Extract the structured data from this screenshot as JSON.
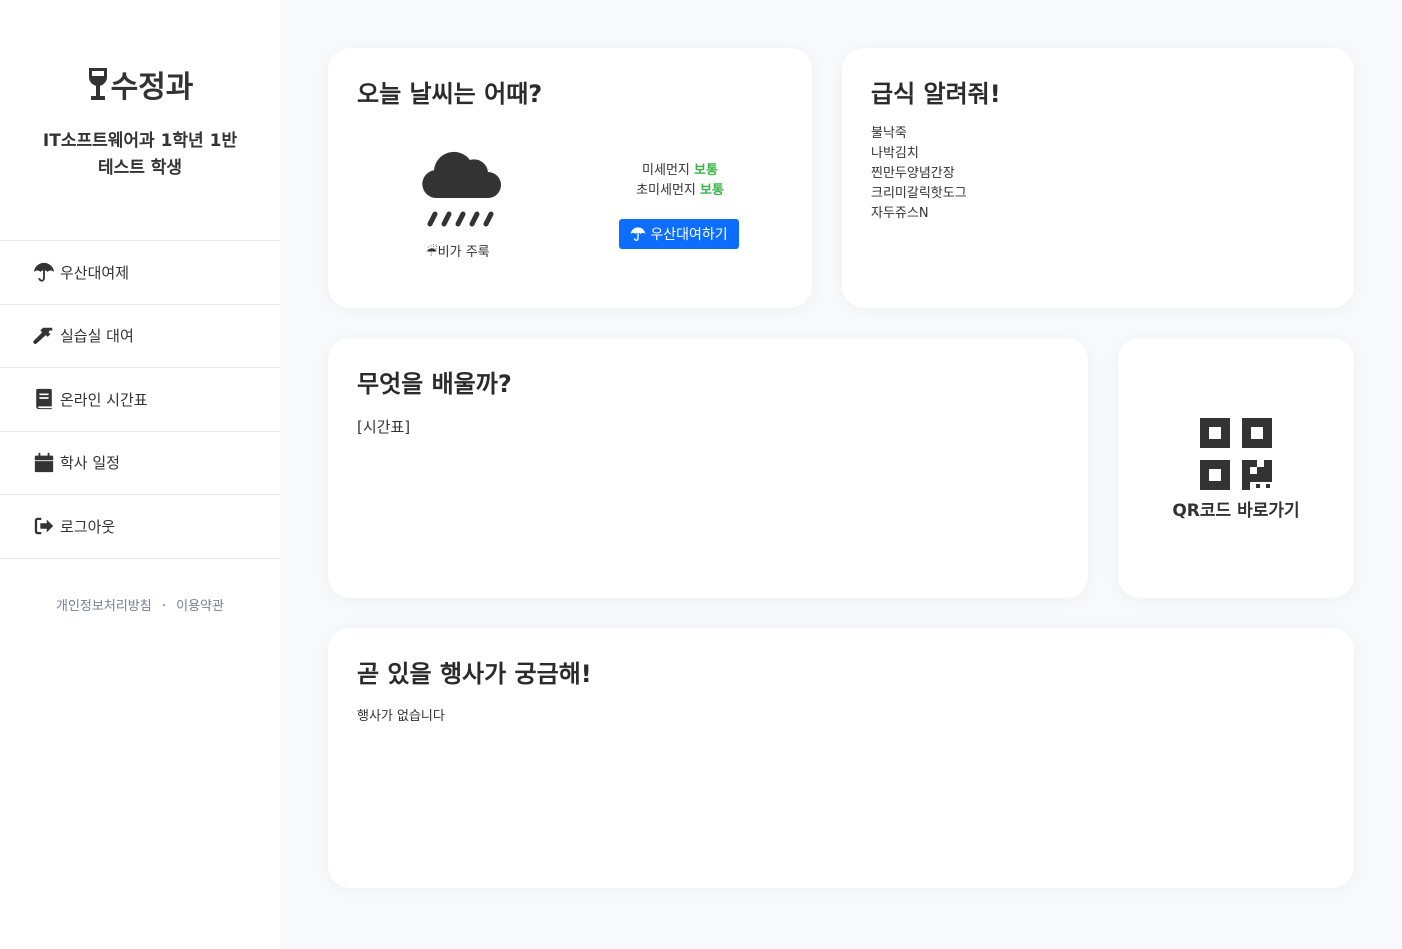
{
  "brand": {
    "title": "수정과",
    "class_line": "IT소프트웨어과 1학년 1반",
    "student_name": "테스트 학생",
    "icon": "wine-glass-icon"
  },
  "nav": [
    {
      "label": "우산대여제",
      "icon": "umbrella-icon"
    },
    {
      "label": "실습실 대여",
      "icon": "hammer-icon"
    },
    {
      "label": "온라인 시간표",
      "icon": "book-icon"
    },
    {
      "label": "학사 일정",
      "icon": "calendar-icon"
    },
    {
      "label": "로그아웃",
      "icon": "sign-out-icon"
    }
  ],
  "footer": {
    "privacy": "개인정보처리방침",
    "separator": "·",
    "terms": "이용약관"
  },
  "weather": {
    "title": "오늘 날씨는 어때?",
    "condition": "☔비가 주룩",
    "fine_dust_label": "미세먼지",
    "fine_dust_value": "보통",
    "ultrafine_dust_label": "초미세먼지",
    "ultrafine_dust_value": "보통",
    "rent_button": "우산대여하기",
    "good_color": "#3bb54a",
    "button_color": "#0d6efd"
  },
  "meal": {
    "title": "급식 알려줘!",
    "items": [
      "불낙죽",
      "나박김치",
      "찐만두양념간장",
      "크리미갈릭핫도그",
      "자두쥬스N"
    ]
  },
  "timetable": {
    "title": "무엇을 배울까?",
    "content": "[시간표]"
  },
  "qr": {
    "label": "QR코드 바로가기",
    "icon": "qrcode-icon"
  },
  "events": {
    "title": "곧 있을 행사가 궁금해!",
    "content": "행사가 없습니다"
  }
}
